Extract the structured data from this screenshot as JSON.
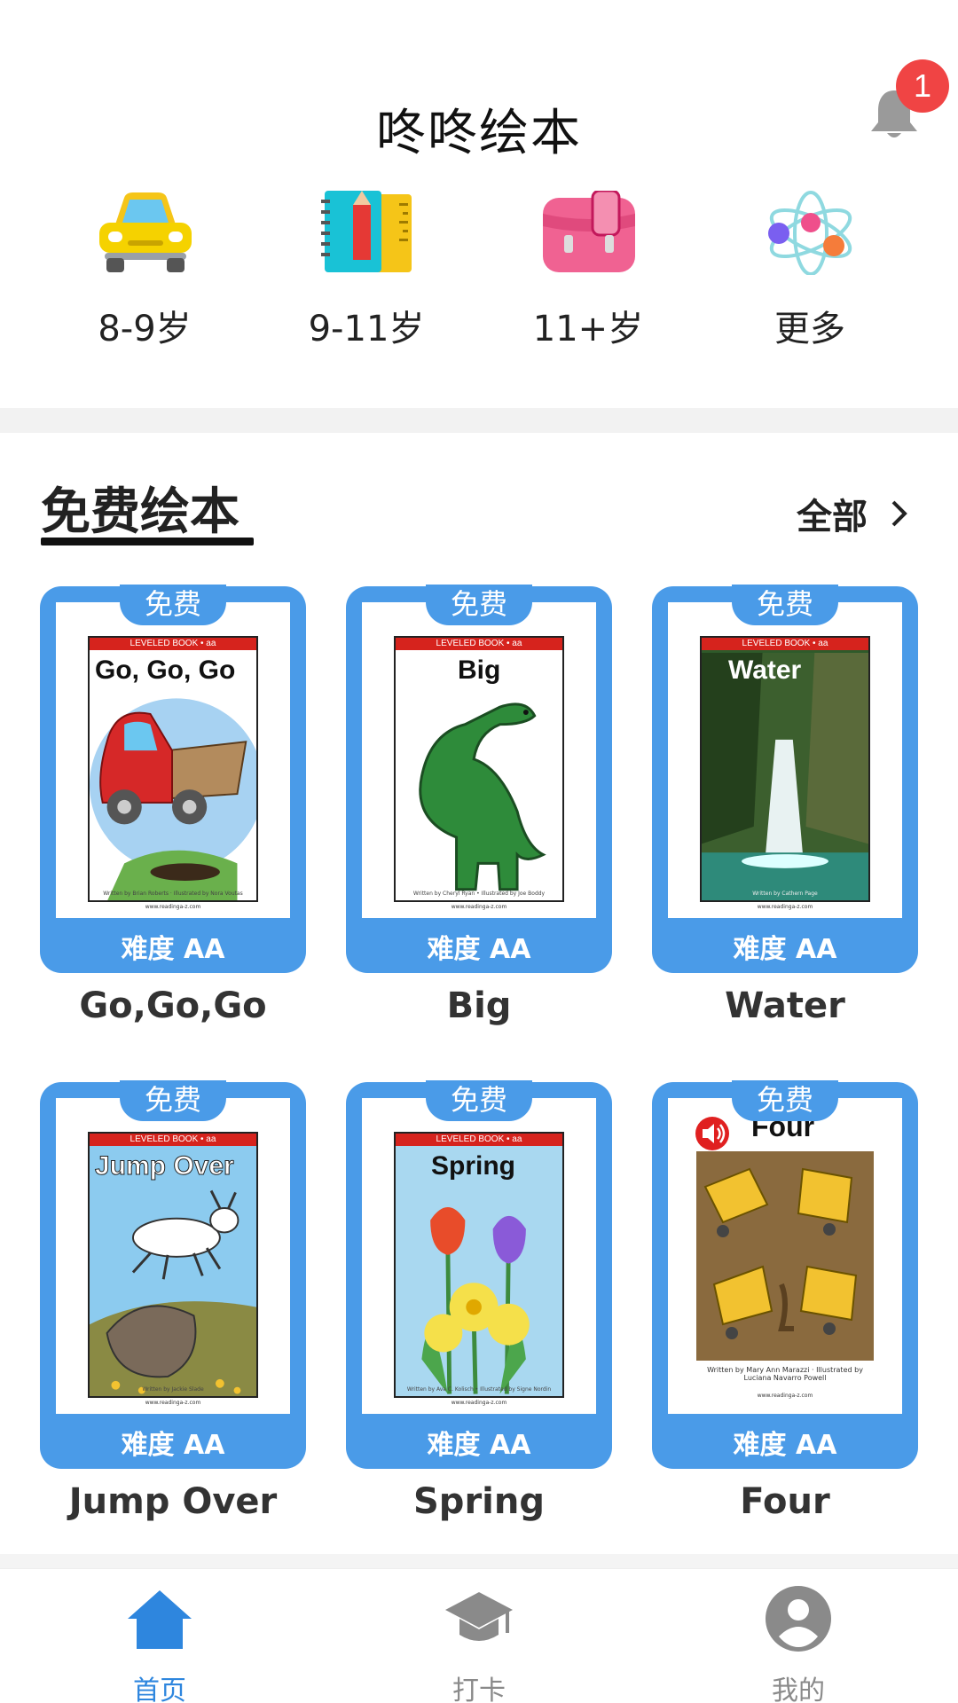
{
  "header": {
    "title": "咚咚绘本",
    "notification_count": "1"
  },
  "categories": [
    {
      "label": "8-9岁",
      "icon": "car-icon"
    },
    {
      "label": "9-11岁",
      "icon": "notebook-pencil-icon"
    },
    {
      "label": "11+岁",
      "icon": "backpack-icon"
    },
    {
      "label": "更多",
      "icon": "atom-icon"
    }
  ],
  "section": {
    "title": "免费绘本",
    "more_label": "全部"
  },
  "books": [
    {
      "name": "Go,Go,Go",
      "badge": "免费",
      "level": "难度 AA",
      "cover_title": "Go, Go, Go",
      "series_label": "LEVELED BOOK • aa",
      "credit": "Written by Brian Roberts · Illustrated by Nora Voutas",
      "site": "www.readinga-z.com"
    },
    {
      "name": "Big",
      "badge": "免费",
      "level": "难度 AA",
      "cover_title": "Big",
      "series_label": "LEVELED BOOK • aa",
      "credit": "Written by Cheryl Ryan • Illustrated by Joe Boddy",
      "site": "www.readinga-z.com"
    },
    {
      "name": "Water",
      "badge": "免费",
      "level": "难度 AA",
      "cover_title": "Water",
      "series_label": "LEVELED BOOK • aa",
      "credit": "Written by Cathern Page",
      "site": "www.readinga-z.com"
    },
    {
      "name": "Jump Over",
      "badge": "免费",
      "level": "难度 AA",
      "cover_title": "Jump Over",
      "series_label": "LEVELED BOOK • aa",
      "credit": "Written by Jackie Slade",
      "site": "www.readinga-z.com"
    },
    {
      "name": "Spring",
      "badge": "免费",
      "level": "难度 AA",
      "cover_title": "Spring",
      "series_label": "LEVELED BOOK • aa",
      "credit": "Written by Ava C. Kolisch • Illustrated by Signe Nordin",
      "site": "www.readinga-z.com"
    },
    {
      "name": "Four",
      "badge": "免费",
      "level": "难度 AA",
      "cover_title": "Four",
      "series_label": "",
      "credit": "Written by Mary Ann Marazzi · Illustrated by Luciana Navarro Powell",
      "site": "www.readinga-z.com"
    }
  ],
  "nav": [
    {
      "label": "首页",
      "icon": "home-icon",
      "active": true
    },
    {
      "label": "打卡",
      "icon": "graduation-cap-icon",
      "active": false
    },
    {
      "label": "我的",
      "icon": "profile-icon",
      "active": false
    }
  ],
  "colors": {
    "accent": "#4a9be8",
    "nav_active": "#2e86de",
    "nav_inactive": "#8a8a8a",
    "badge": "#f04444"
  }
}
